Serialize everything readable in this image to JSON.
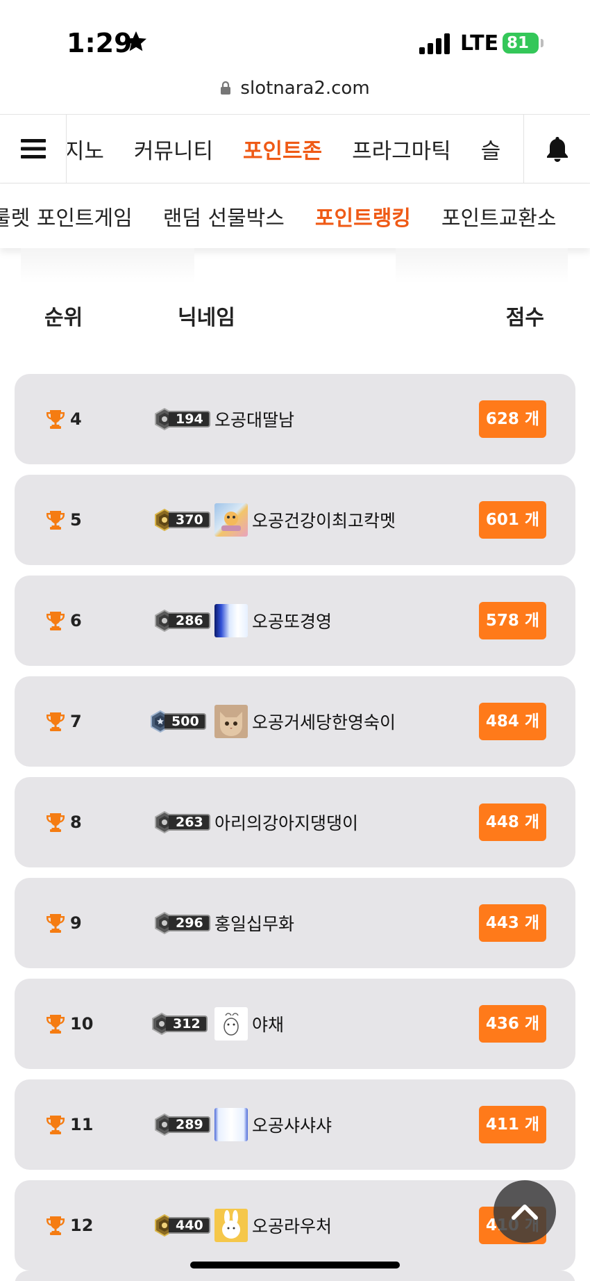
{
  "status_bar": {
    "time": "1:29",
    "network": "LTE",
    "battery": "81"
  },
  "url_bar": {
    "url": "slotnara2.com"
  },
  "main_nav": {
    "items": [
      {
        "label": "카지노",
        "visible": "·지노"
      },
      {
        "label": "커뮤니티"
      },
      {
        "label": "포인트존",
        "active": true
      },
      {
        "label": "프라그마틱"
      },
      {
        "label": "슬"
      }
    ]
  },
  "sub_nav": {
    "items": [
      {
        "label": "룰렛 포인트게임"
      },
      {
        "label": "랜덤 선물박스"
      },
      {
        "label": "포인트랭킹",
        "active": true
      },
      {
        "label": "포인트교환소"
      }
    ]
  },
  "table": {
    "headers": {
      "rank": "순위",
      "nickname": "닉네임",
      "score": "점수"
    },
    "rows": [
      {
        "rank": "4",
        "level": "194",
        "nickname": "오공대딸남",
        "score": "628 개",
        "avatar": null
      },
      {
        "rank": "5",
        "level": "370",
        "nickname": "오공건강이최고칵멧",
        "score": "601 개",
        "avatar": "cartoon"
      },
      {
        "rank": "6",
        "level": "286",
        "nickname": "오공또경영",
        "score": "578 개",
        "avatar": "blue-glow"
      },
      {
        "rank": "7",
        "level": "500",
        "nickname": "오공거세당한영숙이",
        "score": "484 개",
        "avatar": "cat"
      },
      {
        "rank": "8",
        "level": "263",
        "nickname": "아리의강아지댕댕이",
        "score": "448 개",
        "avatar": null
      },
      {
        "rank": "9",
        "level": "296",
        "nickname": "홍일십무화",
        "score": "443 개",
        "avatar": null
      },
      {
        "rank": "10",
        "level": "312",
        "nickname": "야채",
        "score": "436 개",
        "avatar": "sketch"
      },
      {
        "rank": "11",
        "level": "289",
        "nickname": "오공샤샤샤",
        "score": "411 개",
        "avatar": "pale-blue"
      },
      {
        "rank": "12",
        "level": "440",
        "nickname": "오공라우처",
        "score": "410 개",
        "avatar": "bunny"
      }
    ]
  },
  "colors": {
    "accent": "#ef5a16",
    "score_badge": "#ff7a1a",
    "trophy": "#f57c12",
    "row_bg": "#e6e5e8"
  },
  "icons": [
    "star-icon",
    "signal-icon",
    "lock-icon",
    "menu-icon",
    "bell-icon",
    "trophy-icon",
    "chevron-up-icon"
  ]
}
